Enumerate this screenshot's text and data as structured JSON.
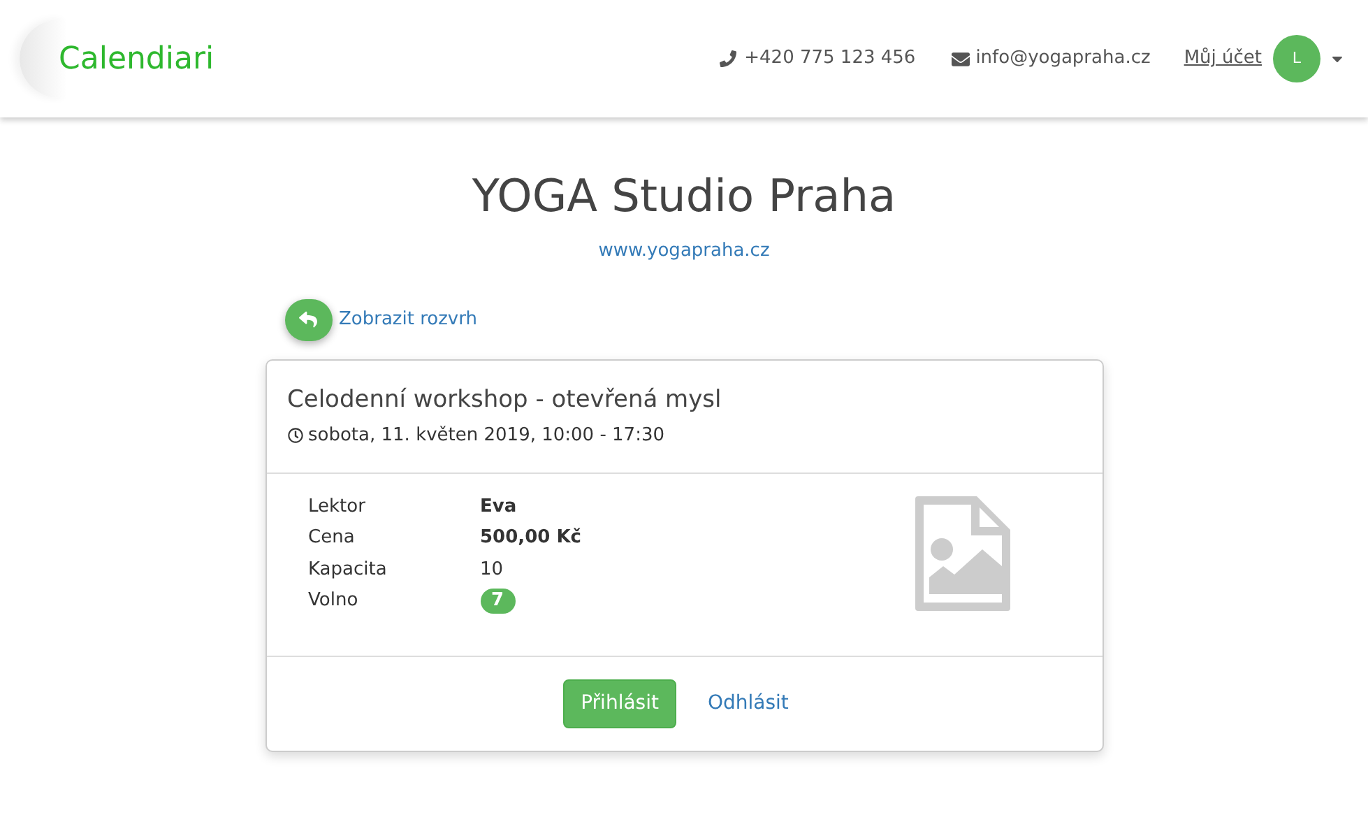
{
  "header": {
    "logo": "Calendiari",
    "phone": "+420 775 123 456",
    "email": "info@yogapraha.cz",
    "account_link": "Můj účet",
    "avatar_initial": "L"
  },
  "studio": {
    "name": "YOGA Studio Praha",
    "website": "www.yogapraha.cz"
  },
  "back_link": "Zobrazit rozvrh",
  "event": {
    "title": "Celodenní workshop - otevřená mysl",
    "datetime": "sobota, 11. květen 2019, 10:00 - 17:30",
    "details": [
      {
        "label": "Lektor",
        "value": "Eva",
        "kind": "bold"
      },
      {
        "label": "Cena",
        "value": "500,00 Kč",
        "kind": "bold"
      },
      {
        "label": "Kapacita",
        "value": "10",
        "kind": "plain"
      },
      {
        "label": "Volno",
        "value": "7",
        "kind": "badge"
      }
    ],
    "image": {
      "kind": "placeholder"
    },
    "actions": [
      {
        "label": "Přihlásit",
        "kind": "primary"
      },
      {
        "label": "Odhlásit",
        "kind": "link"
      }
    ]
  }
}
